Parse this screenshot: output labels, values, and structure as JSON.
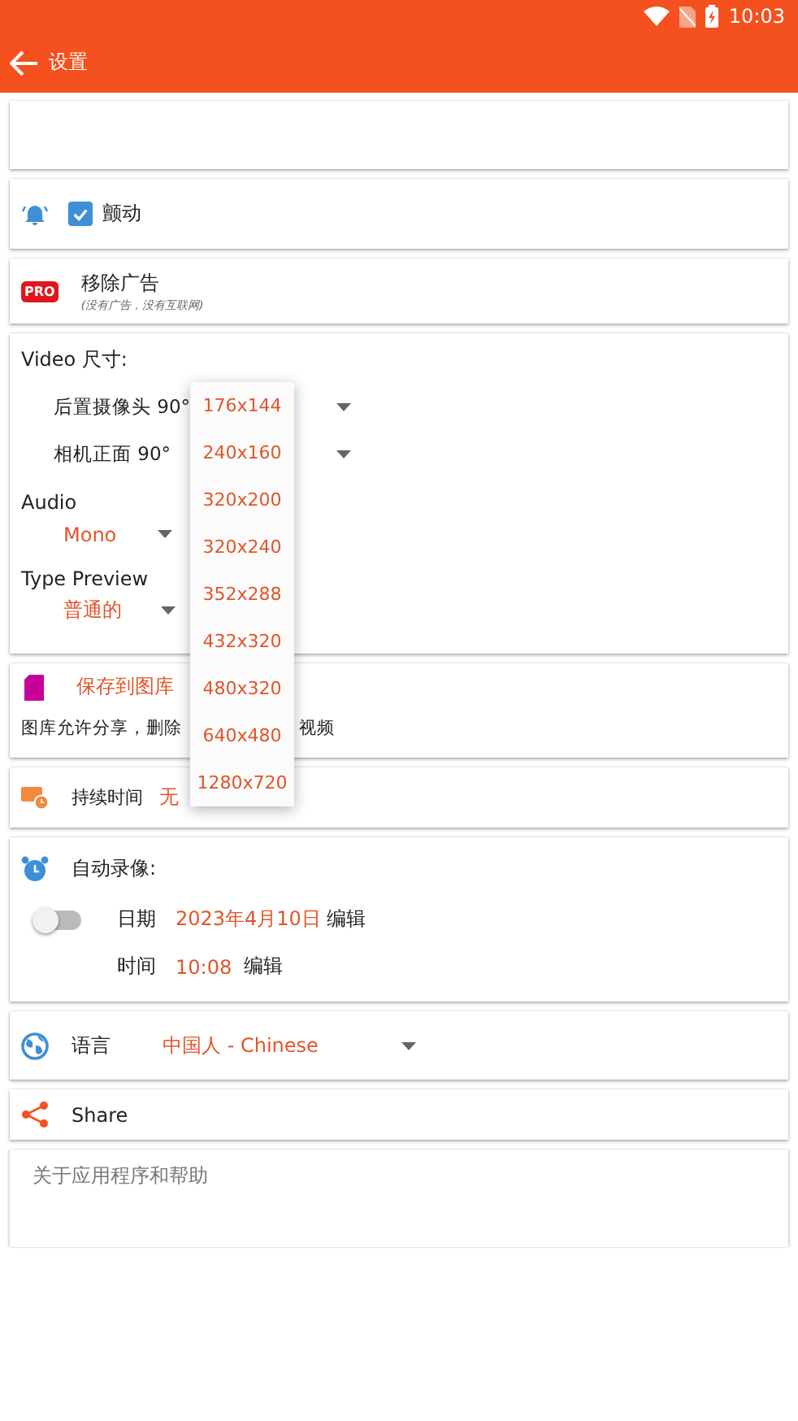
{
  "status_bar": {
    "time": "10:03"
  },
  "app_bar": {
    "title": "设置"
  },
  "vibrate": {
    "label": "颤动",
    "checked": true
  },
  "remove_ads": {
    "badge": "PRO",
    "title": "移除广告",
    "subtitle": "(没有广告，没有互联网)"
  },
  "video": {
    "label": "Video 尺寸:",
    "rows": [
      {
        "label": "后置摄像头 90°"
      },
      {
        "label": "相机正面 90°"
      }
    ],
    "audio_label": "Audio",
    "audio_value": "Mono",
    "preview_label": "Type Preview",
    "preview_value": "普通的"
  },
  "gallery": {
    "title": "保存到图库",
    "note_start": "图库允许分享，删除",
    "note_end": "视频"
  },
  "duration": {
    "label": "持续时间",
    "value": "无"
  },
  "auto_record": {
    "title": "自动录像:",
    "on": false,
    "date_label": "日期",
    "date": "2023年4月10日",
    "date_edit": "编辑",
    "time_label": "时间",
    "time": "10:08",
    "time_edit": "编辑"
  },
  "language": {
    "label": "语言",
    "value": "中国人 - Chinese"
  },
  "share": {
    "label": "Share"
  },
  "about": {
    "label": "关于应用程序和帮助"
  },
  "size_menu": {
    "options": [
      {
        "label": "176x144"
      },
      {
        "label": "240x160"
      },
      {
        "label": "320x200"
      },
      {
        "label": "320x240"
      },
      {
        "label": "352x288"
      },
      {
        "label": "432x320"
      },
      {
        "label": "480x320"
      },
      {
        "label": "640x480"
      },
      {
        "label": "1280x720"
      }
    ]
  }
}
